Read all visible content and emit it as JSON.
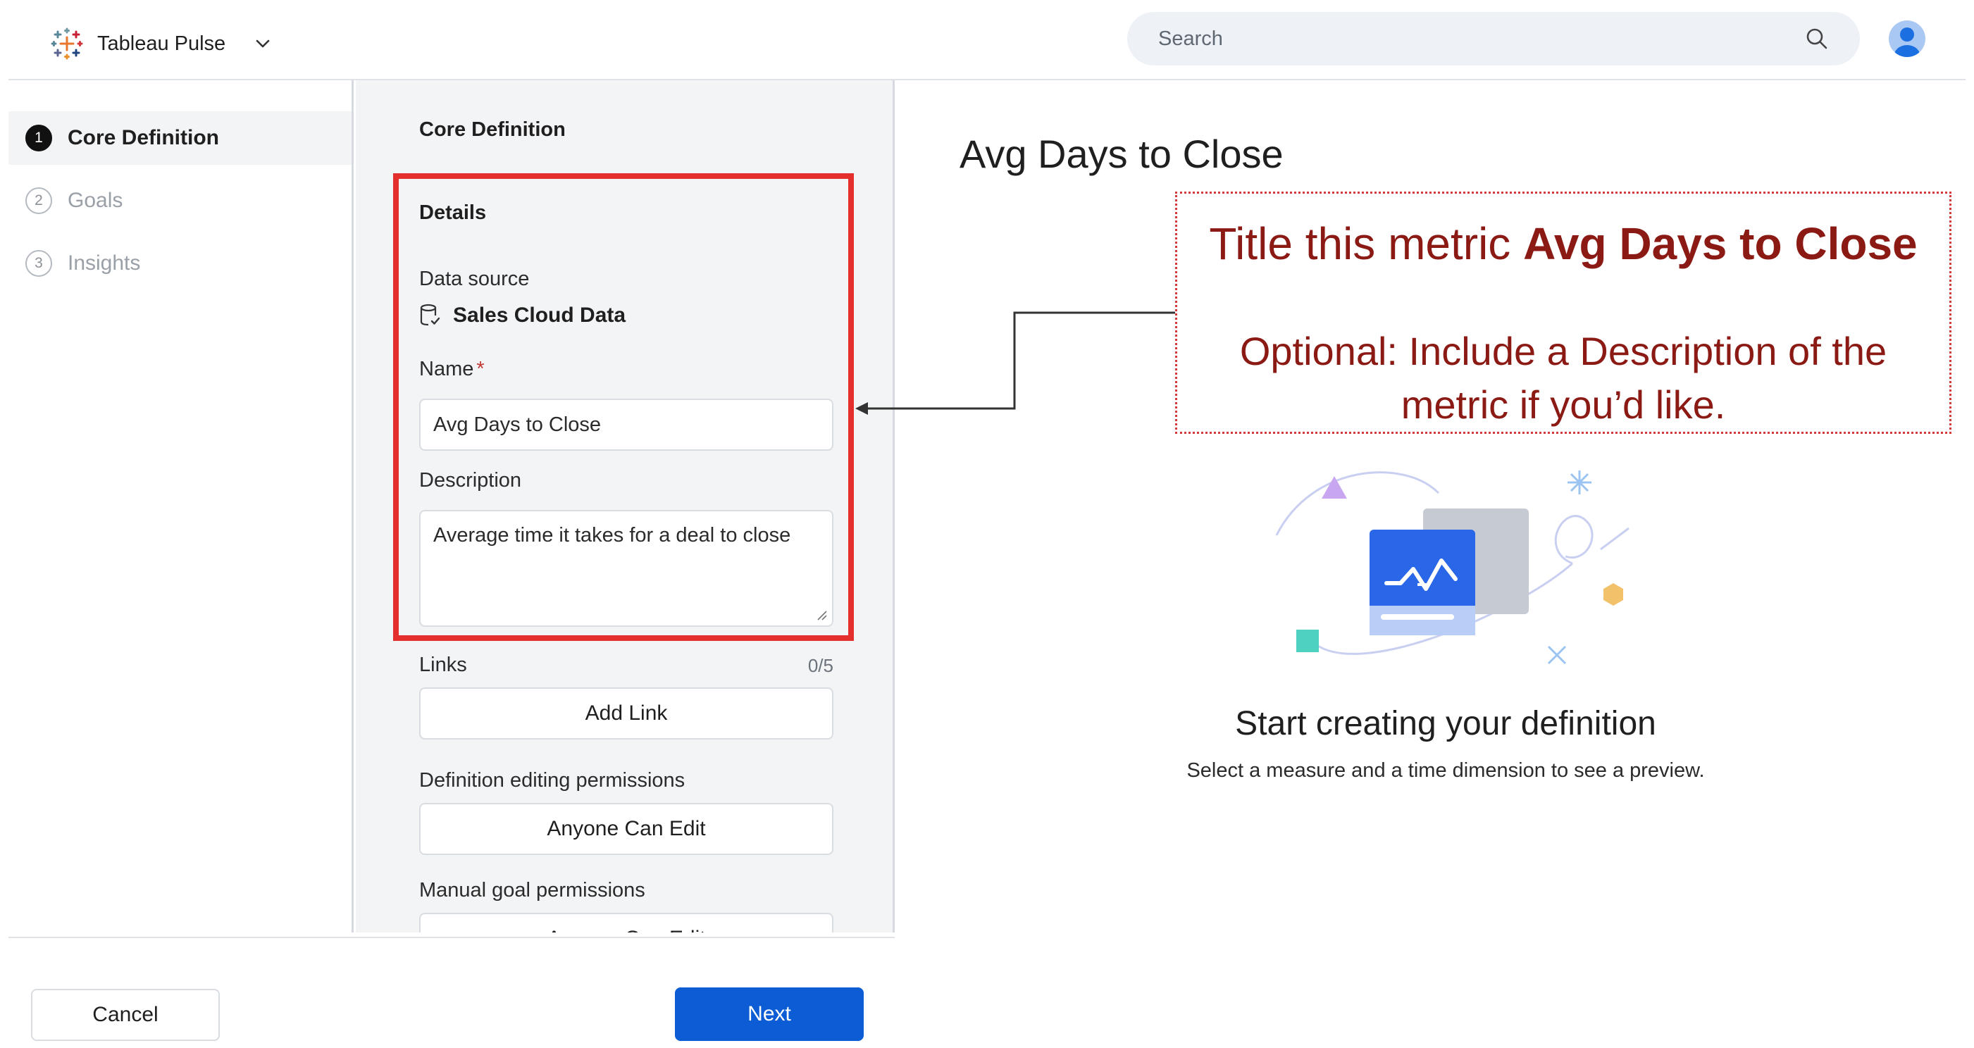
{
  "header": {
    "app_name": "Tableau Pulse",
    "search_placeholder": "Search"
  },
  "steps": [
    {
      "number": "1",
      "label": "Core Definition"
    },
    {
      "number": "2",
      "label": "Goals"
    },
    {
      "number": "3",
      "label": "Insights"
    }
  ],
  "form": {
    "section_title": "Core Definition",
    "details_title": "Details",
    "data_source_label": "Data source",
    "data_source_value": "Sales Cloud Data",
    "name_label": "Name",
    "name_required_mark": "*",
    "name_value": "Avg Days to Close",
    "description_label": "Description",
    "description_value": "Average time it takes for a deal to close",
    "links_label": "Links",
    "links_count": "0/5",
    "add_link_label": "Add Link",
    "edit_permissions_label": "Definition editing permissions",
    "edit_permissions_value": "Anyone Can Edit",
    "goal_permissions_label": "Manual goal permissions",
    "goal_permissions_value": "Anyone Can Edit"
  },
  "footer": {
    "cancel_label": "Cancel",
    "next_label": "Next"
  },
  "preview": {
    "title": "Avg Days to Close",
    "empty_title": "Start creating your definition",
    "empty_subtitle": "Select a measure and a time dimension to see a preview."
  },
  "callout": {
    "line1_prefix": "Title this metric ",
    "line1_bold": "Avg Days to Close",
    "line2": "Optional: Include a Description of the metric if you’d like."
  },
  "colors": {
    "highlight": "#e3302d",
    "callout_text": "#8b1a14",
    "primary_button": "#0b5cd5"
  }
}
